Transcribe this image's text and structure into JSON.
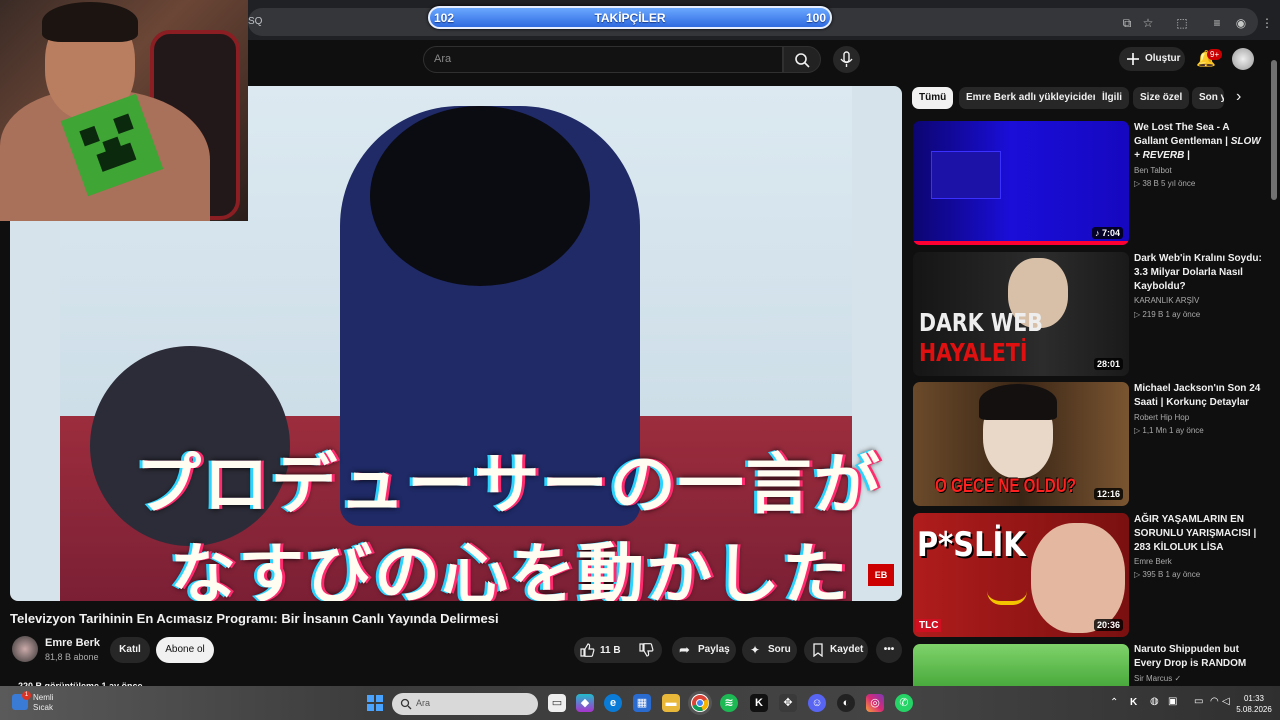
{
  "browser": {
    "url_fragment": "SQ"
  },
  "overlay": {
    "label": "TAKİPÇİLER",
    "left_count": "102",
    "right_count": "100"
  },
  "youtube": {
    "search_placeholder": "Ara",
    "create_label": "Oluştur",
    "notifications_badge": "9+"
  },
  "video": {
    "caption_line1": "プロデューサーの一言が",
    "caption_line2": "なすびの心を動かした",
    "title": "Televizyon Tarihinin En Acımasız Programı: Bir İnsanın Canlı Yayında Delirmesi",
    "channel": "Emre Berk",
    "subscribers": "81,8 B abone",
    "join_label": "Katıl",
    "subscribe_label": "Abone ol",
    "likes": "11 B",
    "share_label": "Paylaş",
    "ask_label": "Soru",
    "save_label": "Kaydet",
    "views_line": "220 B görüntüleme  1 ay önce"
  },
  "chips": [
    "Tümü",
    "Emre Berk adlı yükleyiciden",
    "İlgili",
    "Size özel",
    "Son y"
  ],
  "related": [
    {
      "title_a": "We Lost The Sea - A Gallant Gentleman | ",
      "title_b": "SLOW + REVERB",
      "title_c": " |",
      "channel": "Ben Talbot",
      "meta": "▷ 38 B   5 yıl önce",
      "duration": "♪ 7:04",
      "colors": [
        "#0a06c9",
        "#1b0fe0"
      ]
    },
    {
      "title": "Dark Web'in Kralını Soydu: 3.3 Milyar Dolarla Nasıl Kayboldu?",
      "channel": "KARANLIK ARŞİV",
      "meta": "▷ 219 B   1 ay önce",
      "duration": "28:01",
      "thumb_text_1": "DARK WEB",
      "thumb_text_2": "HAYALETİ",
      "colors": [
        "#1a1a1a",
        "#3a3a3a"
      ]
    },
    {
      "title": "Michael Jackson'ın Son 24 Saati | Korkunç Detaylar",
      "channel": "Robert Hip Hop",
      "meta": "▷ 1,1 Mn   1 ay önce",
      "duration": "12:16",
      "thumb_text_1": "O GECE NE OLDU?",
      "colors": [
        "#5a3a22",
        "#2a1a10"
      ]
    },
    {
      "title": "AĞIR YAŞAMLARIN EN SORUNLU YARIŞMACISI | 283 KİLOLUK LİSA",
      "channel": "Emre Berk",
      "meta": "▷ 395 B   1 ay önce",
      "duration": "20:36",
      "thumb_text_1": "P*SLİK",
      "thumb_text_2": "TLC",
      "colors": [
        "#a01818",
        "#6a0e0e"
      ]
    },
    {
      "title": "Naruto Shippuden but Every Drop is RANDOM",
      "channel": "Sir Marcus ✓",
      "colors": [
        "#6fd05a",
        "#3c9a2e"
      ]
    }
  ],
  "taskbar": {
    "weather_line1": "Nemli",
    "weather_line2": "Sıcak",
    "search_placeholder": "Ara",
    "time": "01:33",
    "date": "5.08.2026"
  }
}
